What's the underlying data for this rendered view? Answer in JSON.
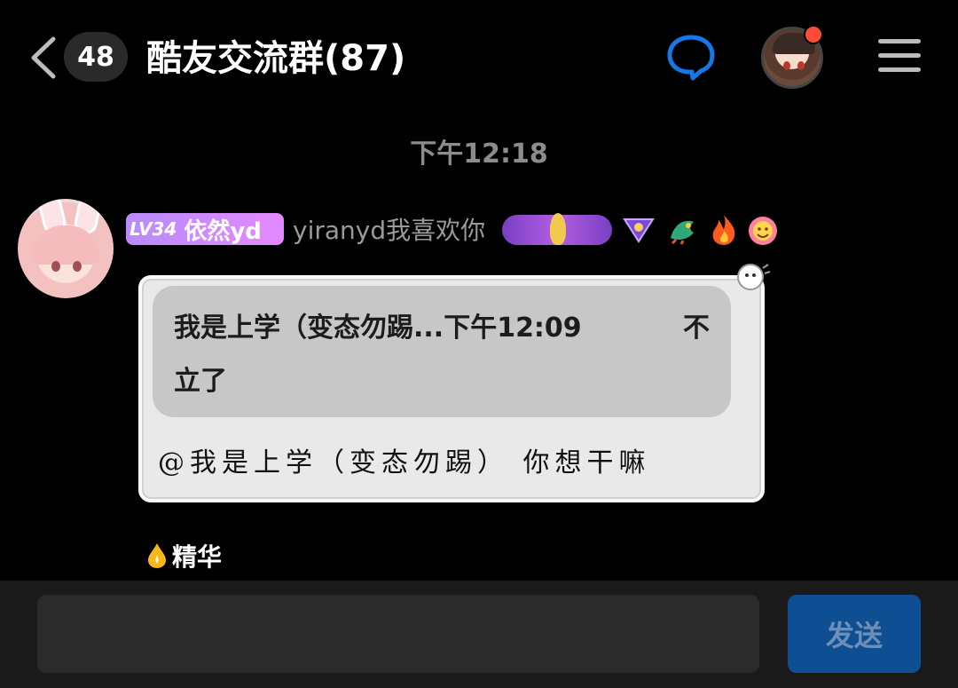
{
  "header": {
    "back_icon": "chevron-left-icon",
    "unread_count": "48",
    "title": "酷友交流群(87)",
    "chat_icon": "chat-bubble-icon",
    "menu_icon": "hamburger-menu-icon",
    "accent_color": "#1677e6"
  },
  "chat": {
    "time_label": "下午12:18",
    "message": {
      "level": "LV34",
      "nickname": "依然yd",
      "sender_name": "yiranyd我喜欢你",
      "badges": [
        "medal-icon",
        "triangle-badge-icon",
        "dragon-icon",
        "fire-icon",
        "flower-emoji-icon"
      ],
      "quote": {
        "author_and_time": "我是上学（变态勿踢...下午12:09",
        "text_tail": "不",
        "text_line2": "立了"
      },
      "reply": "@我是上学（变态勿踢） 你想干嘛"
    },
    "essence_label": "精华"
  },
  "composer": {
    "input_value": "",
    "input_placeholder": "",
    "send_label": "发送",
    "send_color": "#0e4f94"
  }
}
